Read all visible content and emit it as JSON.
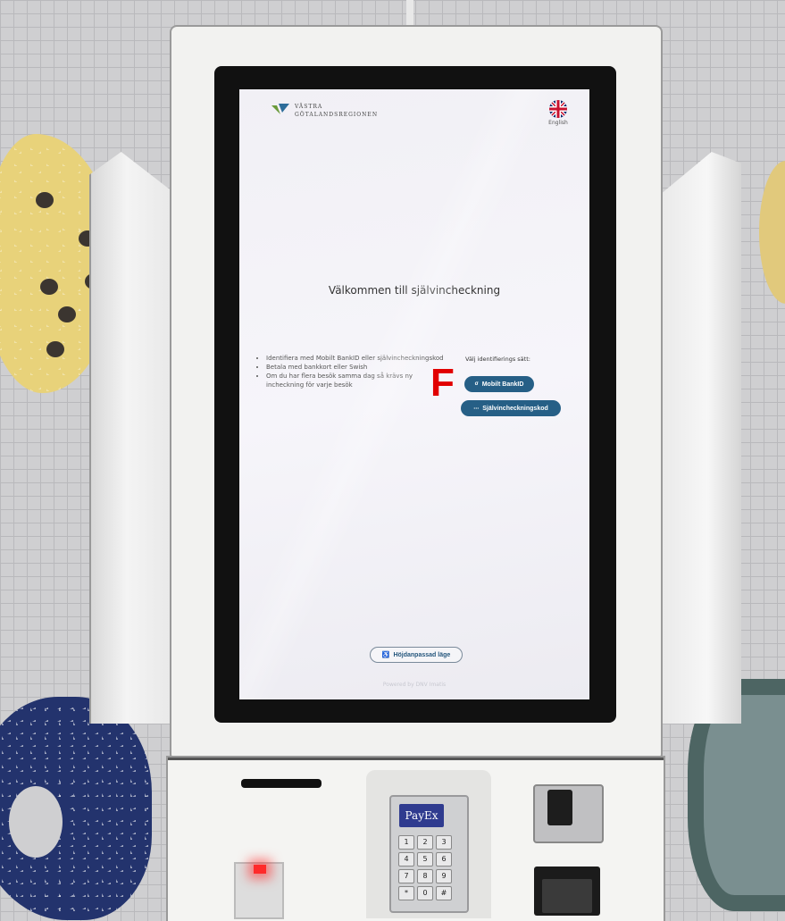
{
  "kiosk_screen": {
    "logo": {
      "line1": "VÄSTRA",
      "line2": "GÖTALANDSREGIONEN"
    },
    "language": {
      "label": "English",
      "icon": "uk-flag-icon"
    },
    "welcome_title": "Välkommen till självincheckning",
    "info_bullets": [
      "Identifiera med Mobilt BankID eller självincheckningskod",
      "Betala med bankkort eller Swish",
      "Om du har flera besök samma dag så krävs ny incheckning för varje besök"
    ],
    "identification": {
      "prompt": "Välj identifierings sätt:",
      "bankid_button": "Mobilt BankID",
      "bankid_icon": "bankid-icon",
      "code_button": "Självincheckningskod",
      "code_icon": "keypad-icon"
    },
    "accessibility_button": "Höjdanpassad läge",
    "accessibility_icon": "wheelchair-icon",
    "powered_by": "Powered by DNV Imatis"
  },
  "annotation_marker": "F",
  "payment_terminal": {
    "brand": "PayEx",
    "keys": [
      "1",
      "2",
      "3",
      "4",
      "5",
      "6",
      "7",
      "8",
      "9",
      "*",
      "0",
      "#"
    ]
  },
  "colors": {
    "button_primary": "#265f86",
    "marker_red": "#e10000",
    "screen_bg": "#f3f2f7"
  }
}
